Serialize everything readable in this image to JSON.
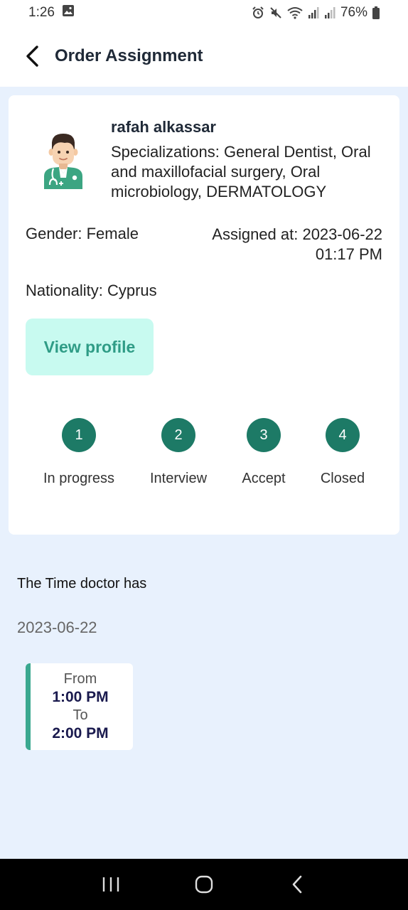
{
  "status_bar": {
    "time": "1:26",
    "battery": "76%"
  },
  "app_bar": {
    "title": "Order Assignment"
  },
  "doctor": {
    "name": "rafah alkassar",
    "specializations": "Specializations: General Dentist, Oral and maxillofacial surgery, Oral microbiology, DERMATOLOGY",
    "gender": "Gender: Female",
    "assigned_at_line1": "Assigned at: 2023-06-22",
    "assigned_at_line2": "01:17 PM",
    "nationality": "Nationality: Cyprus",
    "view_profile_label": "View profile"
  },
  "steps": [
    {
      "number": "1",
      "label": "In progress"
    },
    {
      "number": "2",
      "label": "Interview"
    },
    {
      "number": "3",
      "label": "Accept"
    },
    {
      "number": "4",
      "label": "Closed"
    }
  ],
  "schedule": {
    "heading": "The Time doctor has",
    "date": "2023-06-22",
    "slot": {
      "from_label": "From",
      "from": "1:00 PM",
      "to_label": "To",
      "to": "2:00 PM"
    }
  },
  "colors": {
    "accent": "#1d7a66",
    "button_bg": "#c8faf0",
    "page_bg": "#e8f1fd"
  }
}
